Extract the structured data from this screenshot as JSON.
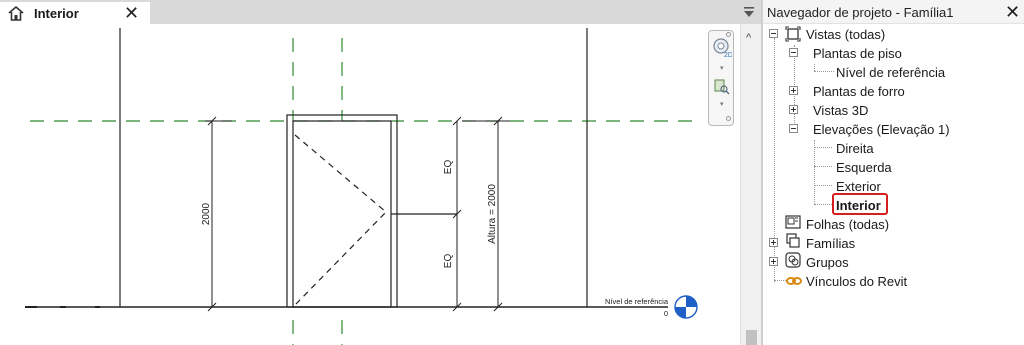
{
  "view_tab": {
    "label": "Interior"
  },
  "drawing": {
    "dim_height": "2000",
    "dim_eq_top": "EQ",
    "dim_eq_bottom": "EQ",
    "dim_altura": "Altura = 2000",
    "level_name": "Nível de referência",
    "level_value": "0"
  },
  "browser": {
    "title": "Navegador de projeto - Família1",
    "items": [
      {
        "label": "Vistas (todas)"
      },
      {
        "label": "Plantas de piso"
      },
      {
        "label": "Nível de referência"
      },
      {
        "label": "Plantas de forro"
      },
      {
        "label": "Vistas 3D"
      },
      {
        "label": "Elevações (Elevação 1)"
      },
      {
        "label": "Direita"
      },
      {
        "label": "Esquerda"
      },
      {
        "label": "Exterior"
      },
      {
        "label": "Interior"
      },
      {
        "label": "Folhas (todas)"
      },
      {
        "label": "Famílias"
      },
      {
        "label": "Grupos"
      },
      {
        "label": "Vínculos do Revit"
      }
    ],
    "selected_item": "Interior"
  },
  "colors": {
    "reference_plane": "#2e8b2e",
    "selection": "#d21f1f",
    "level_marker": "#1d5fc7"
  }
}
